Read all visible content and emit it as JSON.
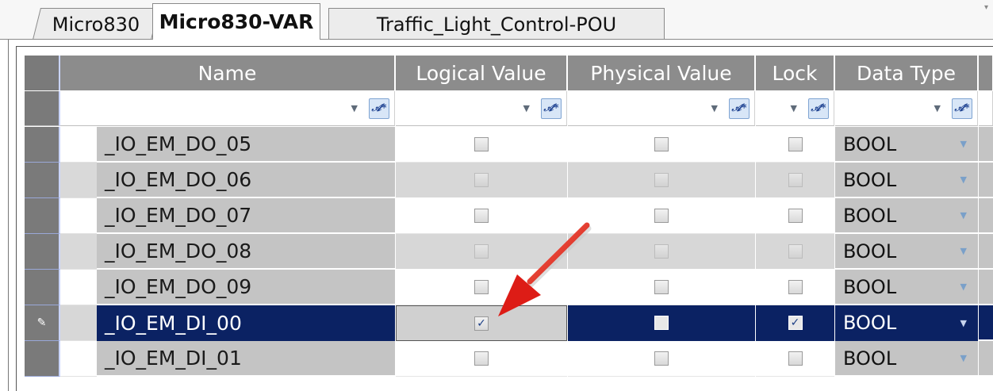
{
  "tabs": [
    {
      "label": "Micro830",
      "active": false
    },
    {
      "label": "Micro830-VAR",
      "active": true
    },
    {
      "label": "Traffic_Light_Control-POU",
      "active": false
    }
  ],
  "columns": {
    "name": "Name",
    "logical_value": "Logical Value",
    "physical_value": "Physical Value",
    "lock": "Lock",
    "data_type": "Data Type"
  },
  "rows": [
    {
      "name": "_IO_EM_DO_05",
      "logical": false,
      "physical": false,
      "lock": false,
      "type": "BOOL"
    },
    {
      "name": "_IO_EM_DO_06",
      "logical": false,
      "physical": false,
      "lock": false,
      "type": "BOOL"
    },
    {
      "name": "_IO_EM_DO_07",
      "logical": false,
      "physical": false,
      "lock": false,
      "type": "BOOL"
    },
    {
      "name": "_IO_EM_DO_08",
      "logical": false,
      "physical": false,
      "lock": false,
      "type": "BOOL"
    },
    {
      "name": "_IO_EM_DO_09",
      "logical": false,
      "physical": false,
      "lock": false,
      "type": "BOOL"
    },
    {
      "name": "_IO_EM_DI_00",
      "logical": true,
      "physical": false,
      "lock": true,
      "type": "BOOL",
      "selected": true
    },
    {
      "name": "_IO_EM_DI_01",
      "logical": false,
      "physical": false,
      "lock": false,
      "type": "BOOL"
    }
  ],
  "icons": {
    "filter_dropdown": "chevron-down-icon",
    "filter_button": "filter-icon",
    "edit_row": "pencil-icon",
    "annotation": "red-arrow"
  },
  "colors": {
    "header_bg": "#8c8c8c",
    "selected_row_bg": "#0b2263",
    "name_cell_bg": "#c4c4c4",
    "arrow": "#e0201c"
  }
}
